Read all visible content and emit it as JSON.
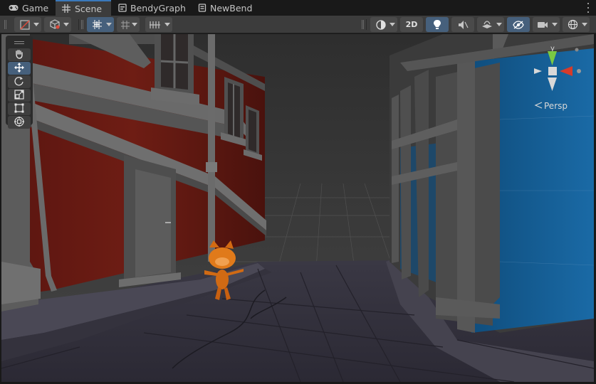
{
  "tabs": [
    {
      "label": "Game",
      "icon": "gamepad-icon",
      "active": false
    },
    {
      "label": "Scene",
      "icon": "grid-hash-icon",
      "active": true
    },
    {
      "label": "BendyGraph",
      "icon": "graph-icon",
      "active": false
    },
    {
      "label": "NewBend",
      "icon": "document-icon",
      "active": false
    }
  ],
  "toolbar": {
    "twod_label": "2D",
    "icons": [
      "draw-mode-icon",
      "shading-cube-icon",
      "move-snap-icon",
      "grid-snap-icon",
      "increment-snap-icon",
      "render-mode-sphere-icon",
      "lighting-bulb-icon",
      "audio-mute-icon",
      "effects-icon",
      "visibility-toggle-icon",
      "camera-icon",
      "gizmos-icon"
    ],
    "accent_color": "#46607c"
  },
  "tools": {
    "items": [
      "hand-tool-icon",
      "move-tool-icon",
      "rotate-tool-icon",
      "scale-tool-icon",
      "rect-tool-icon",
      "transform-tool-icon"
    ],
    "selected": "move-tool-icon"
  },
  "gizmo": {
    "axis_y_label": "y",
    "projection_label": "Persp",
    "axis_colors": {
      "x": "#d63b2a",
      "y": "#7ac943",
      "z": "#3a7bd5"
    }
  }
}
